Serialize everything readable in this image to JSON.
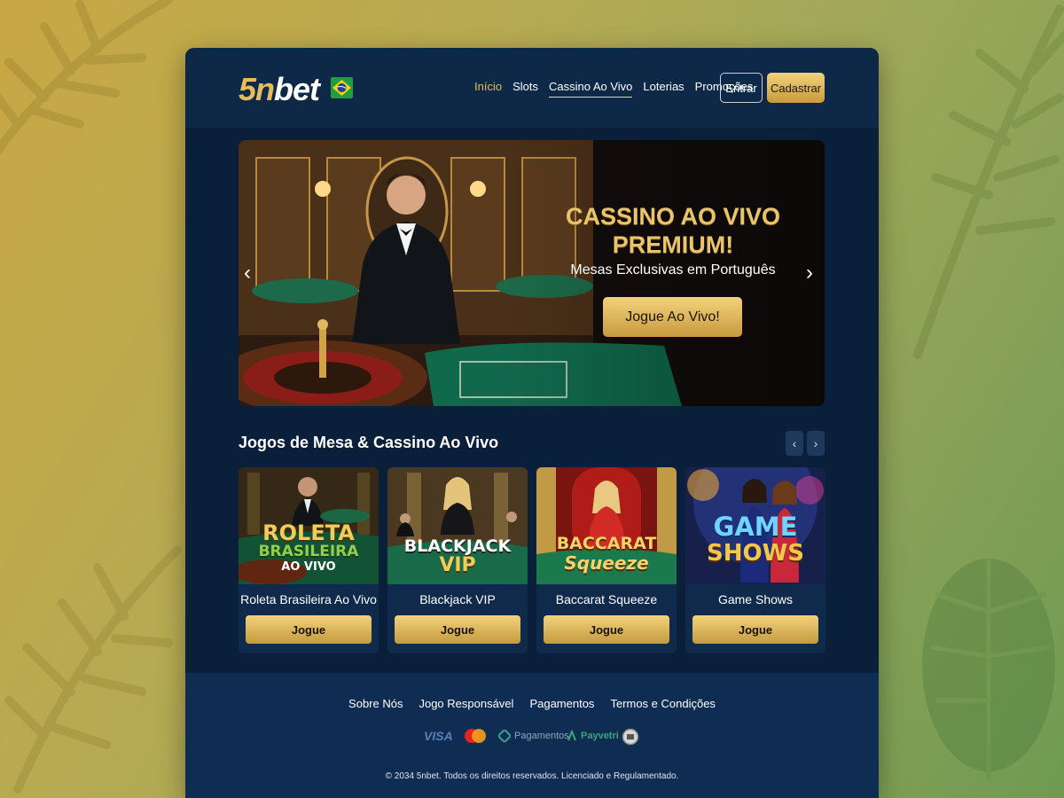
{
  "header": {
    "logo_prefix": "5n",
    "logo_suffix": "bet",
    "flag": "brazil-flag",
    "nav": [
      {
        "label": "Início",
        "key": "inicio"
      },
      {
        "label": "Slots",
        "key": "slots"
      },
      {
        "label": "Cassino Ao Vivo",
        "key": "cassino-ao-vivo"
      },
      {
        "label": "Loterias",
        "key": "loterias"
      },
      {
        "label": "Promoções",
        "key": "promocoes"
      }
    ],
    "active_nav": "Cassino Ao Vivo",
    "login_label": "Entrar",
    "register_label": "Cadastrar"
  },
  "hero": {
    "title_line1": "CASSINO AO VIVO",
    "title_line2": "PREMIUM!",
    "subtitle": "Mesas Exclusivas em Português",
    "cta": "Jogue Ao Vivo!",
    "prev_icon": "chevron-left-icon",
    "next_icon": "chevron-right-icon"
  },
  "section": {
    "title": "Jogos de Mesa & Cassino Ao Vivo",
    "games": [
      {
        "name": "Roleta Brasileira Ao Vivo",
        "art_line1": "ROLETA",
        "art_line2": "BRASILEIRA",
        "art_line3": "AO VIVO",
        "button": "Jogue"
      },
      {
        "name": "Blackjack VIP",
        "art_line1": "BLACKJACK",
        "art_line2": "VIP",
        "button": "Jogue"
      },
      {
        "name": "Baccarat Squeeze",
        "art_line1": "BACCARAT",
        "art_line2": "Squeeze",
        "button": "Jogue"
      },
      {
        "name": "Game Shows",
        "art_line1": "GAME",
        "art_line2": "SHOWS",
        "button": "Jogue"
      }
    ]
  },
  "footer": {
    "links": [
      "Sobre Nós",
      "Jogo Responsável",
      "Pagamentos",
      "Termos e Condições"
    ],
    "payments": [
      "VISA",
      "Pagamentos",
      "Payvetri"
    ],
    "copyright": "© 2034 5nbet. Todos os direitos reservados. Licenciado e Regulamentado."
  },
  "colors": {
    "accent_gold": "#e4bc5a",
    "panel_navy": "#0a1f3a",
    "card_navy": "#102a4c"
  }
}
